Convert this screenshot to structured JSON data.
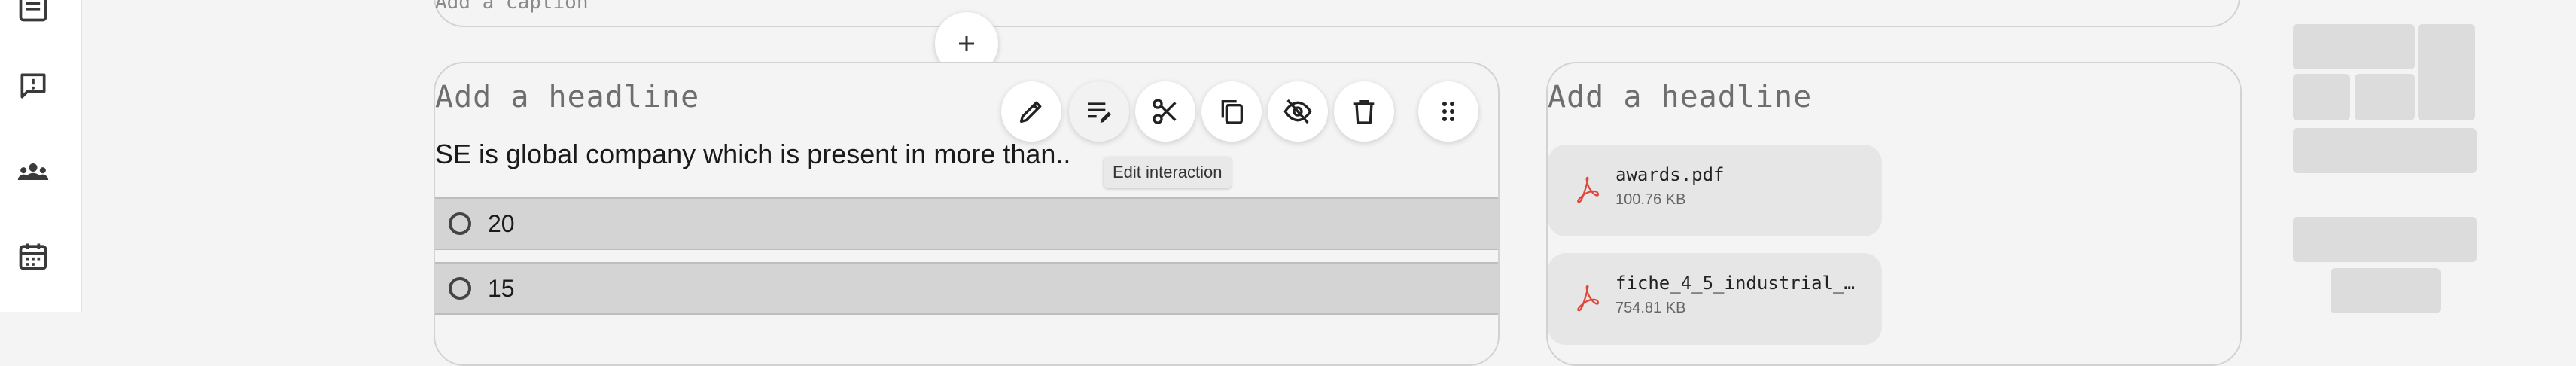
{
  "sidebar": {
    "items": [
      {
        "icon": "list-icon"
      },
      {
        "icon": "feedback-icon"
      },
      {
        "icon": "groups-icon"
      },
      {
        "icon": "calendar-icon"
      }
    ]
  },
  "previous_block": {
    "caption_placeholder": "Add a caption"
  },
  "add_block": {
    "icon": "plus-icon"
  },
  "question_block": {
    "headline_placeholder": "Add a headline",
    "question": "SE is global company which is present in more than..",
    "options": [
      {
        "label": "20"
      },
      {
        "label": "15"
      }
    ]
  },
  "toolbar": {
    "items": [
      {
        "icon": "pencil-icon"
      },
      {
        "icon": "edit-interaction-icon"
      },
      {
        "icon": "scissors-icon"
      },
      {
        "icon": "copy-icon"
      },
      {
        "icon": "eye-off-icon"
      },
      {
        "icon": "trash-icon"
      },
      {
        "icon": "drag-handle-icon"
      }
    ],
    "tooltip": "Edit interaction"
  },
  "files_block": {
    "headline_placeholder": "Add a headline",
    "files": [
      {
        "name": "awards.pdf",
        "size": "100.76 KB",
        "icon": "pdf-icon"
      },
      {
        "name": "fiche_4_5_industrial_h…",
        "size": "754.81 KB",
        "icon": "pdf-icon"
      }
    ]
  },
  "colors": {
    "background": "#f4f4f4",
    "option_fill": "#d4d4d4",
    "pdf_red": "#e0463a",
    "thumbnail": "#dcdcdd"
  }
}
